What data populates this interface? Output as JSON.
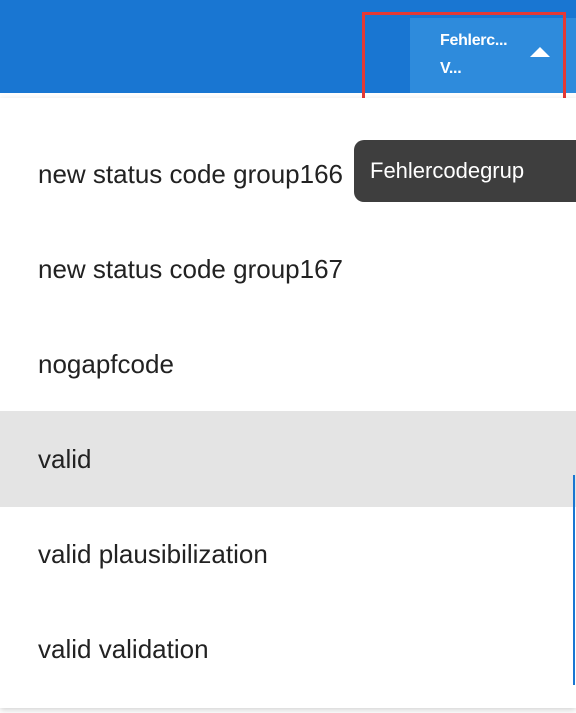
{
  "header": {
    "column_label": "Fehlerc...\nV...",
    "sort_icon": "arrow-up-icon"
  },
  "tooltip": {
    "text": "Fehlercodegrup"
  },
  "menu": {
    "items": [
      {
        "label": "new status code group166"
      },
      {
        "label": "new status code group167"
      },
      {
        "label": "nogapfcode"
      },
      {
        "label": "valid"
      },
      {
        "label": "valid plausibilization"
      },
      {
        "label": "valid validation"
      }
    ],
    "selected_index": 3
  },
  "colors": {
    "header_bar": "#1976d2",
    "header_cell": "#2e8bdc",
    "highlight_border": "#e53935",
    "tooltip_bg": "#3e3e3e",
    "selected_item_bg": "#e4e4e4"
  }
}
